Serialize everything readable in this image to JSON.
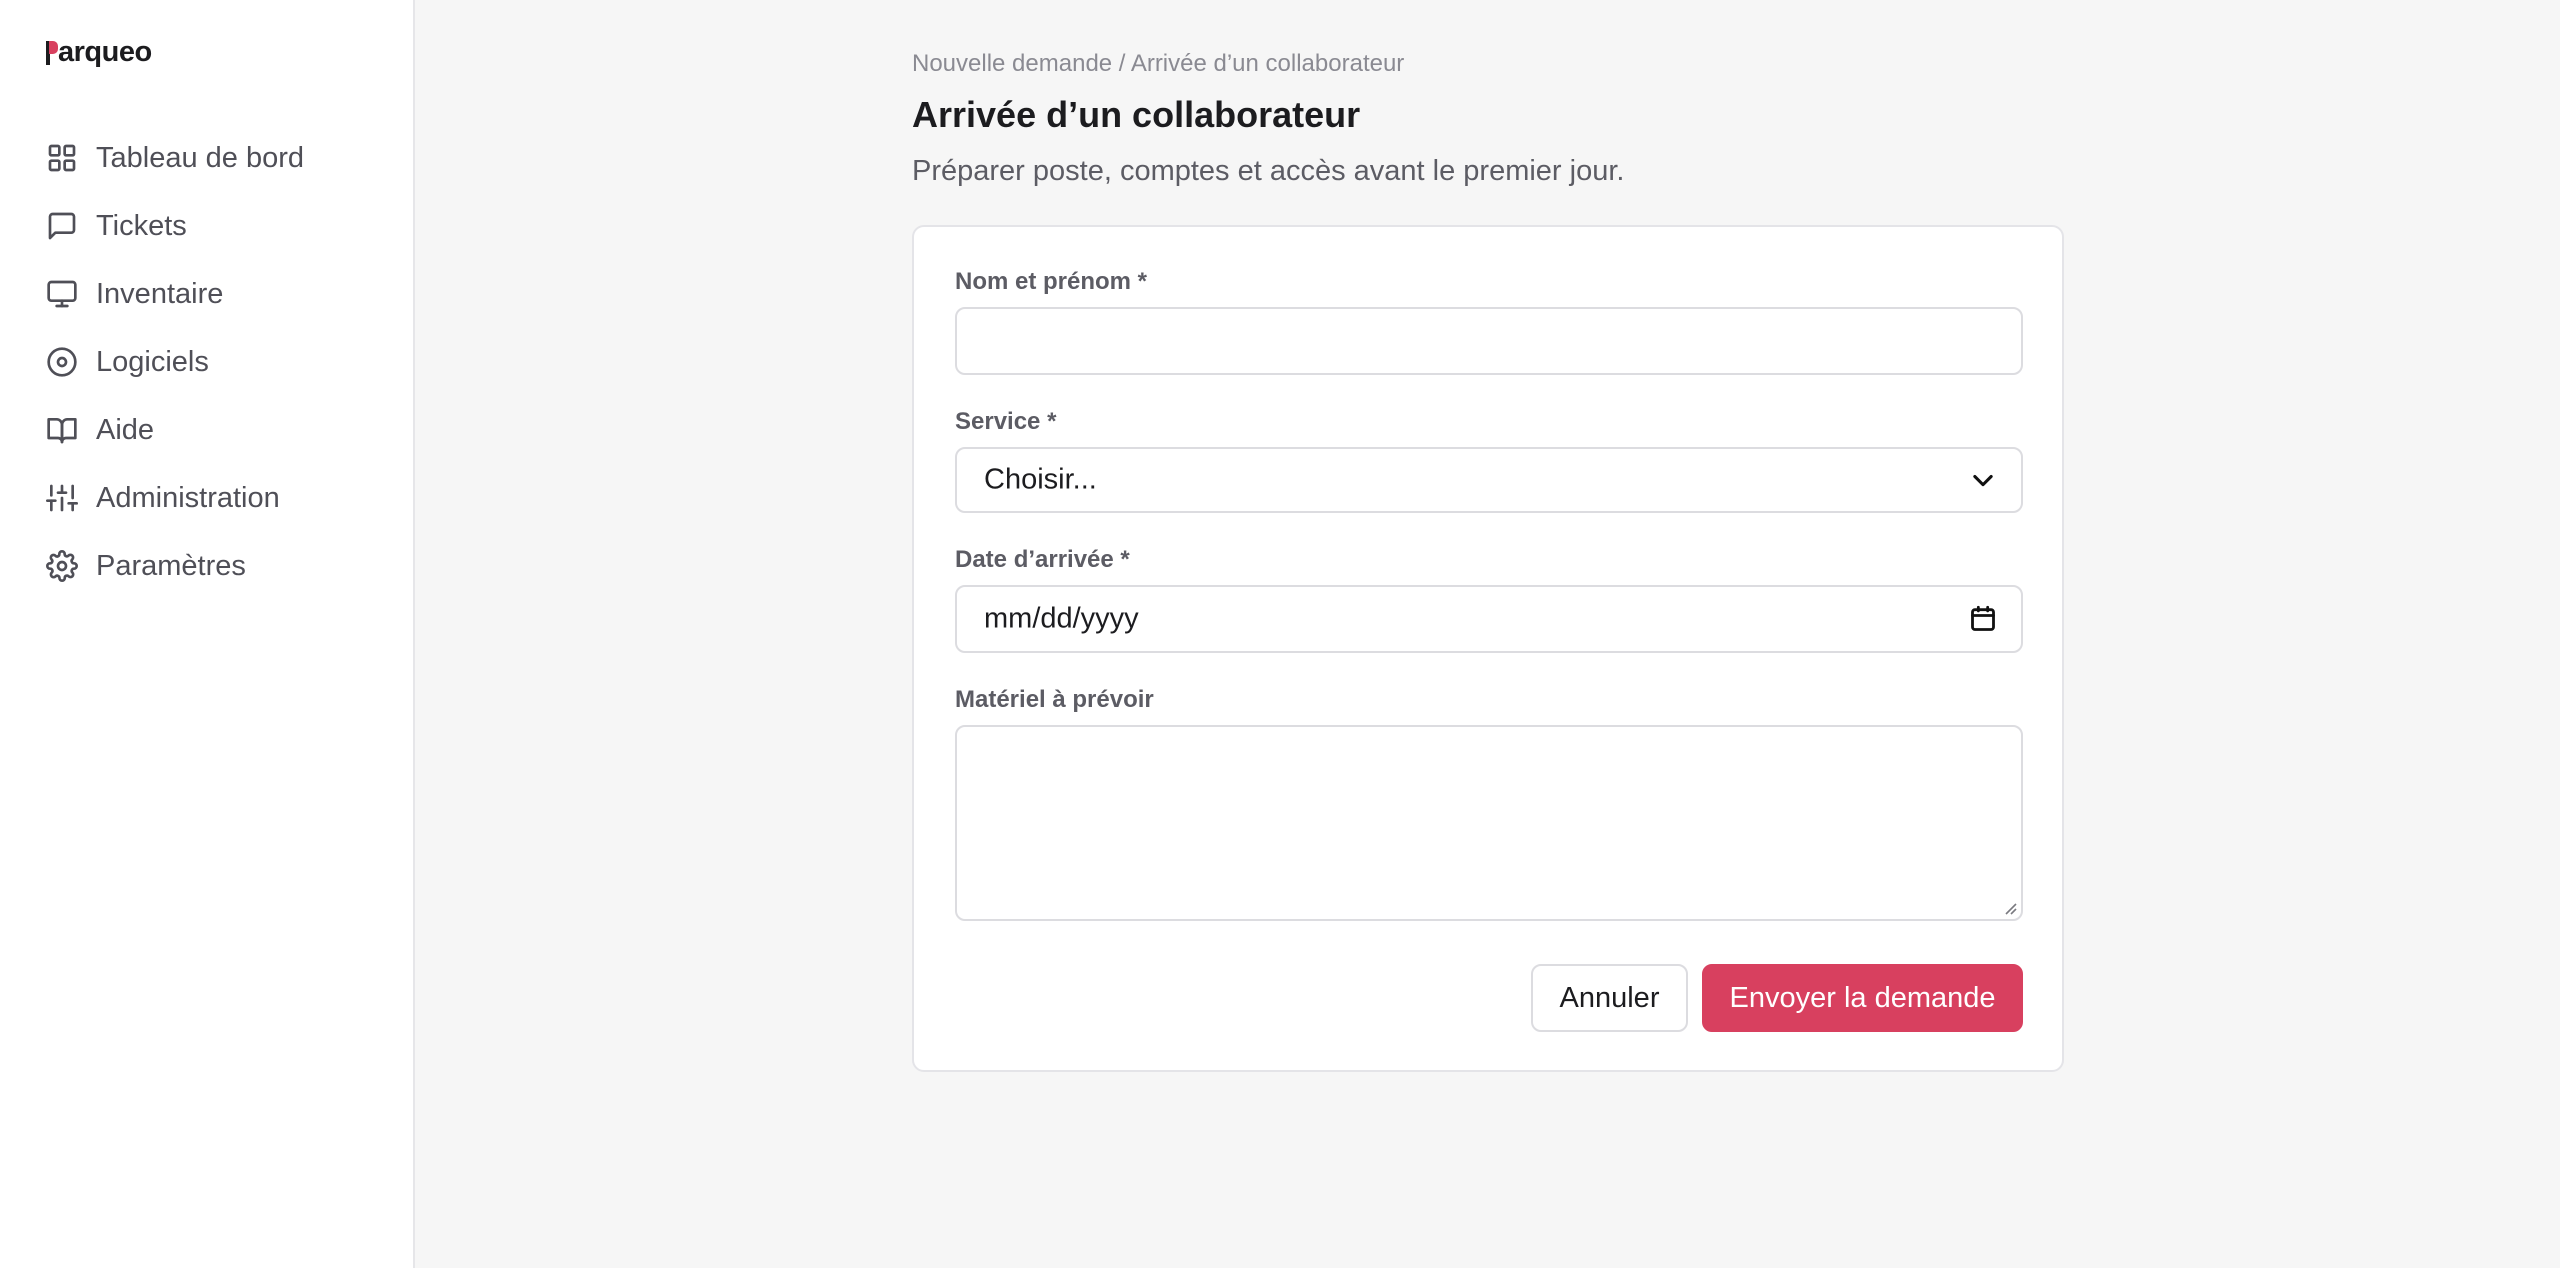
{
  "app": {
    "logo_text": "arqueo",
    "logo_initial": "P",
    "accent_color": "#d8405f"
  },
  "sidebar": {
    "items": [
      {
        "label": "Tableau de bord",
        "icon": "grid-icon"
      },
      {
        "label": "Tickets",
        "icon": "message-square-icon"
      },
      {
        "label": "Inventaire",
        "icon": "monitor-icon"
      },
      {
        "label": "Logiciels",
        "icon": "disc-icon"
      },
      {
        "label": "Aide",
        "icon": "book-open-icon"
      },
      {
        "label": "Administration",
        "icon": "sliders-icon"
      },
      {
        "label": "Paramètres",
        "icon": "settings-icon"
      }
    ]
  },
  "header": {
    "breadcrumb": "Nouvelle demande / Arrivée d’un collaborateur",
    "title": "Arrivée d’un collaborateur",
    "subtitle": "Préparer poste, comptes et accès avant le premier jour."
  },
  "form": {
    "name_label": "Nom et prénom *",
    "name_value": "",
    "service_label": "Service *",
    "service_selected": "Choisir...",
    "date_label": "Date d’arrivée *",
    "date_placeholder": "mm/dd/yyyy",
    "material_label": "Matériel à prévoir",
    "material_value": "",
    "cancel_label": "Annuler",
    "submit_label": "Envoyer la demande"
  }
}
